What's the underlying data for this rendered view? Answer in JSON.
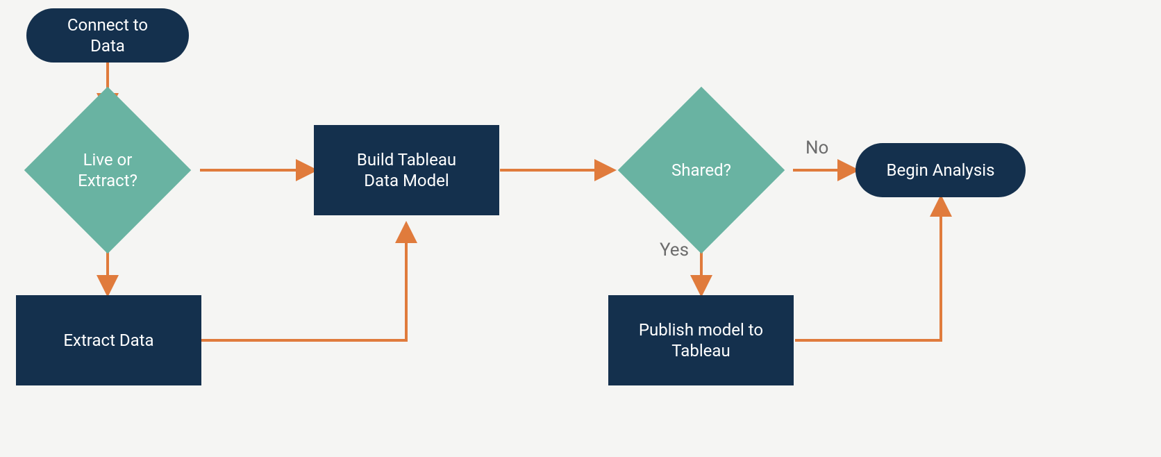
{
  "nodes": {
    "connect": "Connect to\nData",
    "decision_live_extract": "Live or\nExtract?",
    "extract_data": "Extract Data",
    "build_model": "Build Tableau\nData Model",
    "decision_shared": "Shared?",
    "publish_model": "Publish model to\nTableau",
    "begin_analysis": "Begin Analysis"
  },
  "edge_labels": {
    "shared_no": "No",
    "shared_yes": "Yes"
  },
  "colors": {
    "navy": "#14304d",
    "teal": "#69b3a2",
    "arrow": "#e07b3c",
    "label_gray": "#6c6c6c",
    "bg": "#f5f5f3"
  }
}
